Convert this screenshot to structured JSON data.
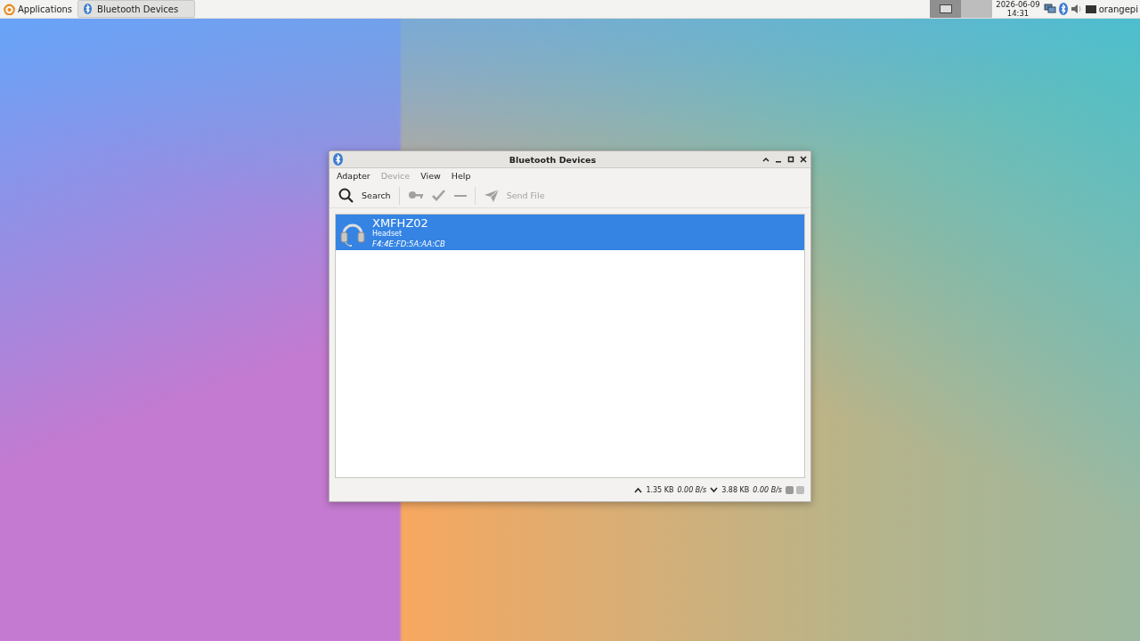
{
  "panel": {
    "app_menu": "Applications",
    "tasks": [
      {
        "label": "Bluetooth Devices",
        "selected": true
      }
    ],
    "workspaces": [
      {
        "selected": true
      },
      {
        "selected": false
      }
    ],
    "clock": {
      "date": "2026-06-09",
      "time": "14:31"
    },
    "user": "orangepi"
  },
  "window": {
    "title": "Bluetooth Devices",
    "menu": [
      {
        "label": "Adapter",
        "disabled": false
      },
      {
        "label": "Device",
        "disabled": true
      },
      {
        "label": "View",
        "disabled": false
      },
      {
        "label": "Help",
        "disabled": false
      }
    ],
    "toolbar": [
      {
        "kind": "search",
        "label": "Search",
        "disabled": false
      },
      {
        "kind": "separator"
      },
      {
        "kind": "key",
        "disabled": true
      },
      {
        "kind": "check",
        "disabled": true
      },
      {
        "kind": "minus",
        "disabled": true
      },
      {
        "kind": "separator"
      },
      {
        "kind": "send",
        "label": "Send File",
        "disabled": true
      }
    ],
    "devices": [
      {
        "name": "XMFHZ02",
        "type": "Headset",
        "address": "F4:4E:FD:5A:AA:CB",
        "selected": true
      }
    ],
    "status": {
      "up_total": "1.35 KB",
      "up_rate": "0.00 B/s",
      "down_total": "3.88 KB",
      "down_rate": "0.00 B/s"
    }
  }
}
